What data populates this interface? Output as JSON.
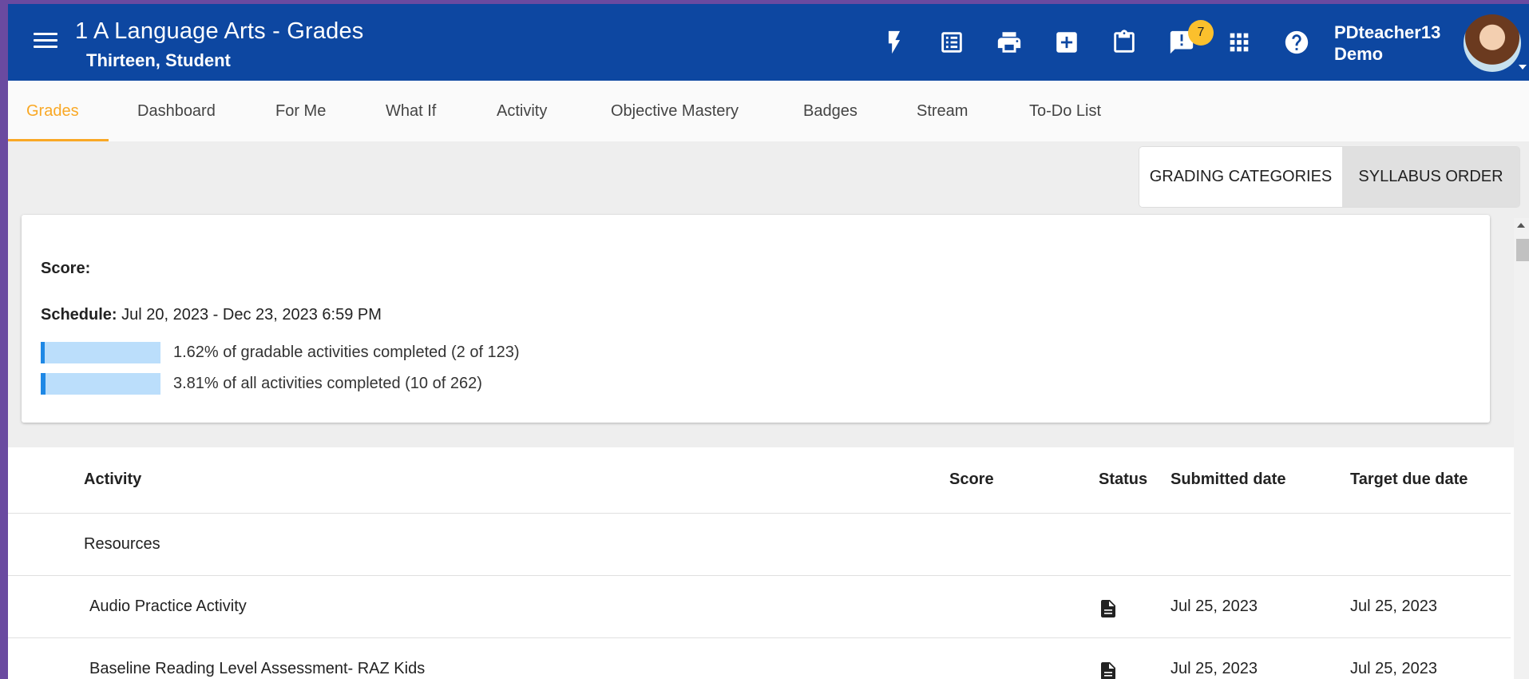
{
  "header": {
    "title": "1 A Language Arts - Grades",
    "subtitle": "Thirteen, Student",
    "notification_count": "7",
    "user_name_line1": "PDteacher13",
    "user_name_line2": "Demo",
    "icons": [
      "flash-icon",
      "checklist-icon",
      "print-icon",
      "add-box-icon",
      "clipboard-icon",
      "announcement-icon",
      "apps-grid-icon",
      "help-icon"
    ]
  },
  "tabs": [
    {
      "label": "Grades",
      "active": true
    },
    {
      "label": "Dashboard"
    },
    {
      "label": "For Me"
    },
    {
      "label": "What If"
    },
    {
      "label": "Activity"
    },
    {
      "label": "Objective Mastery"
    },
    {
      "label": "Badges"
    },
    {
      "label": "Stream"
    },
    {
      "label": "To-Do List"
    }
  ],
  "view_toggle": {
    "grading_categories": "GRADING CATEGORIES",
    "syllabus_order": "SYLLABUS ORDER",
    "selected": "SYLLABUS ORDER"
  },
  "summary": {
    "score_label": "Score:",
    "schedule_label": "Schedule:",
    "schedule_value": " Jul 20, 2023 - Dec 23, 2023 6:59 PM",
    "gradable_progress": {
      "percent": 1.62,
      "text": "1.62% of gradable activities completed (2 of 123)"
    },
    "all_progress": {
      "percent": 3.81,
      "text": "3.81% of all activities completed (10 of 262)"
    }
  },
  "table": {
    "headers": {
      "activity": "Activity",
      "score": "Score",
      "status": "Status",
      "submitted": "Submitted date",
      "due": "Target due date"
    },
    "section": "Resources",
    "rows": [
      {
        "activity": "Audio Practice Activity",
        "status_icon": "document-icon",
        "submitted": "Jul 25, 2023",
        "due": "Jul 25, 2023"
      },
      {
        "activity": "Baseline Reading Level Assessment- RAZ Kids",
        "status_icon": "document-icon",
        "submitted": "Jul 25, 2023",
        "due": "Jul 25, 2023"
      }
    ]
  },
  "colors": {
    "header_bg": "#0d47a1",
    "accent": "#f9a825",
    "progress_bg": "#bbdefb",
    "progress_fill": "#1e88e5",
    "badge": "#fbc02d"
  }
}
